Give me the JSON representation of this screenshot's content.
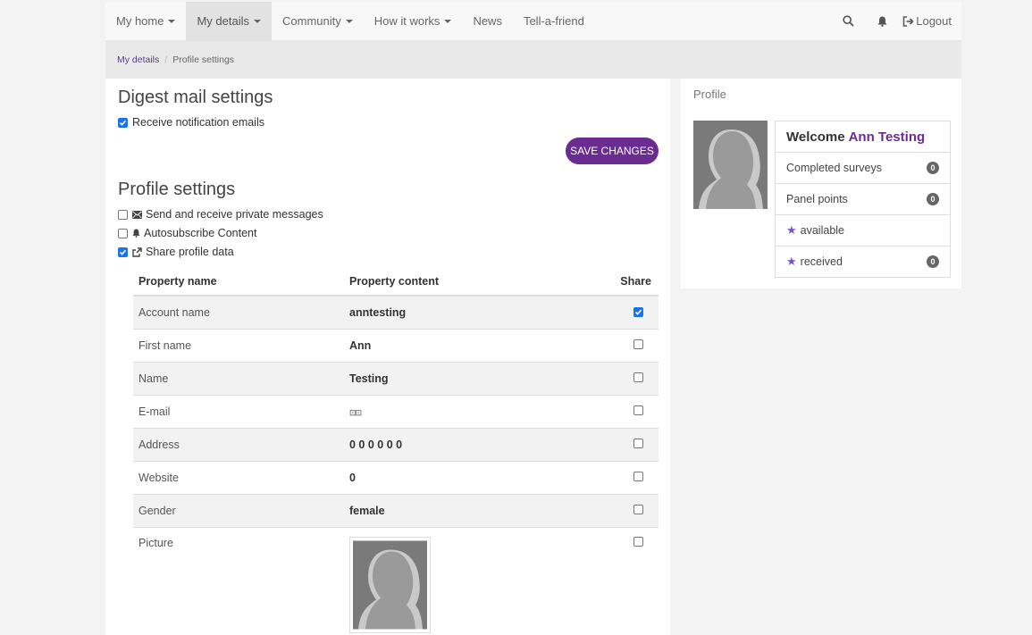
{
  "nav": {
    "items": [
      {
        "label": "My home",
        "caret": true
      },
      {
        "label": "My details",
        "caret": true,
        "active": true
      },
      {
        "label": "Community",
        "caret": true
      },
      {
        "label": "How it works",
        "caret": true
      },
      {
        "label": "News",
        "caret": false
      },
      {
        "label": "Tell-a-friend",
        "caret": false
      }
    ],
    "logout_label": "Logout"
  },
  "breadcrumb": {
    "parent": "My details",
    "current": "Profile settings"
  },
  "digest": {
    "title": "Digest mail settings",
    "notification_label": "Receive notification emails",
    "notification_checked": true,
    "save_label": "SAVE CHANGES"
  },
  "profile_settings": {
    "title": "Profile settings",
    "private_messages_label": "Send and receive private messages",
    "autosubscribe_label": "Autosubscribe Content",
    "share_profile_label": "Share profile data"
  },
  "table": {
    "headers": {
      "name": "Property name",
      "content": "Property content",
      "share": "Share"
    },
    "rows": [
      {
        "name": "Account name",
        "content": "anntesting",
        "share": true
      },
      {
        "name": "First name",
        "content": "Ann",
        "share": false
      },
      {
        "name": "Name",
        "content": "Testing",
        "share": false
      },
      {
        "name": "E-mail",
        "content": "",
        "share": false
      },
      {
        "name": "Address",
        "content": "0 0 0 0 0 0",
        "share": false
      },
      {
        "name": "Website",
        "content": "0",
        "share": false
      },
      {
        "name": "Gender",
        "content": "female",
        "share": false
      },
      {
        "name": "Picture",
        "content": "",
        "share": false
      }
    ]
  },
  "profile_box": {
    "title": "Profile",
    "welcome": "Welcome",
    "user_name": "Ann Testing",
    "completed_surveys_label": "Completed surveys",
    "completed_surveys": "0",
    "panel_points_label": "Panel points",
    "panel_points": "0",
    "available_label": "available",
    "received_label": "received",
    "received": "0"
  },
  "colors": {
    "accent": "#6a2c91",
    "star": "#7b4fd6",
    "checkbox": "#1a73e8"
  }
}
